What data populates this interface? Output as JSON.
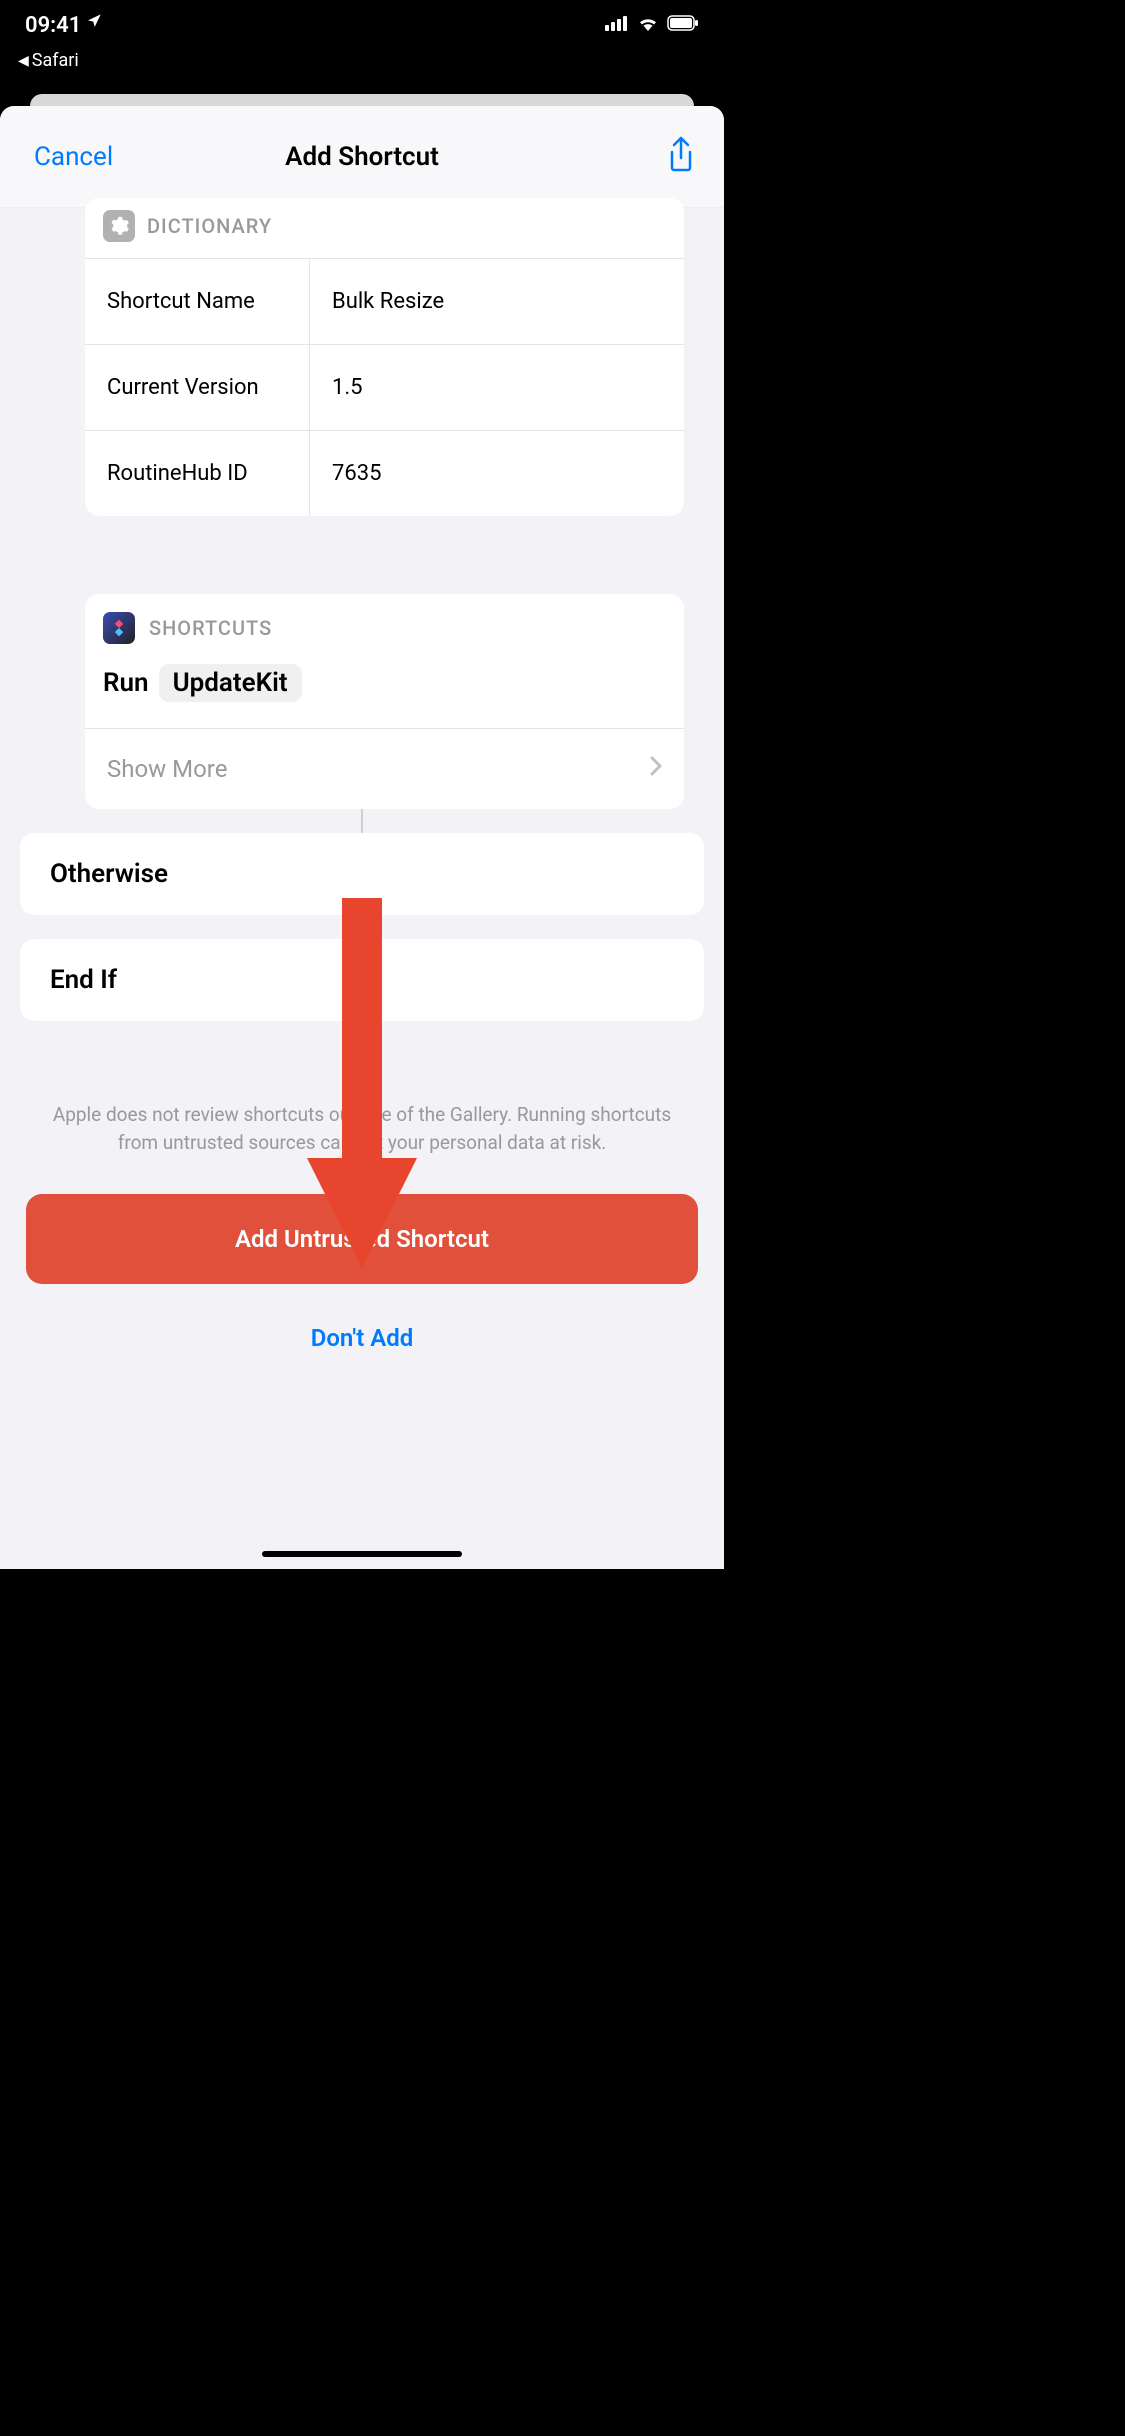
{
  "status": {
    "time": "09:41",
    "back_app": "Safari"
  },
  "header": {
    "cancel": "Cancel",
    "title": "Add Shortcut"
  },
  "dictionary": {
    "label": "DICTIONARY",
    "rows": [
      {
        "key": "Shortcut Name",
        "value": "Bulk Resize"
      },
      {
        "key": "Current Version",
        "value": "1.5"
      },
      {
        "key": "RoutineHub ID",
        "value": "7635"
      }
    ]
  },
  "shortcuts": {
    "label": "SHORTCUTS",
    "run_label": "Run",
    "run_target": "UpdateKit",
    "show_more": "Show More"
  },
  "blocks": {
    "otherwise": "Otherwise",
    "endif": "End If"
  },
  "footer": {
    "disclaimer": "Apple does not review shortcuts outside of the Gallery. Running shortcuts from untrusted sources can put your personal data at risk.",
    "add_button": "Add Untrusted Shortcut",
    "dont_add": "Don't Add"
  }
}
